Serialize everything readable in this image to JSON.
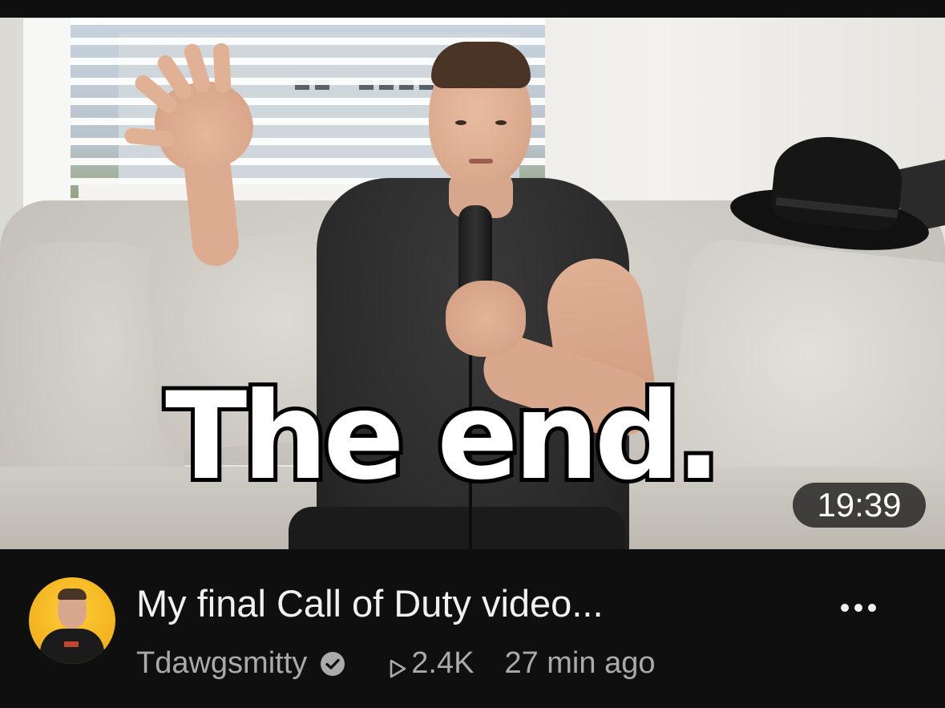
{
  "thumbnail": {
    "overlay_text": "The end.",
    "duration": "19:39"
  },
  "video": {
    "title": "My final Call of Duty video...",
    "channel": "Tdawgsmitty",
    "views": "2.4K",
    "age": "27 min ago"
  },
  "icons": {
    "verified": "verified-check-icon",
    "views": "play-outline-icon",
    "more": "more-options-icon"
  },
  "colors": {
    "background": "#0f0f0f",
    "title_text": "#f1f1f1",
    "meta_text": "#aaaaaa",
    "avatar_bg": "#f2b21b"
  }
}
